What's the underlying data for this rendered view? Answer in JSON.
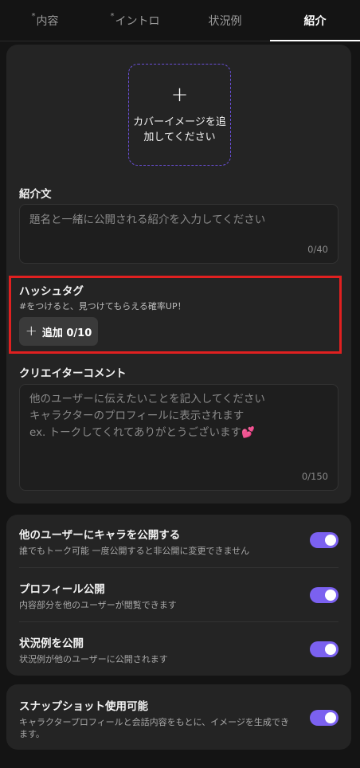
{
  "tabs": [
    {
      "label": "内容",
      "required_mark": "*"
    },
    {
      "label": "イントロ",
      "required_mark": "*"
    },
    {
      "label": "状況例",
      "required_mark": ""
    },
    {
      "label": "紹介",
      "required_mark": ""
    }
  ],
  "active_tab": "紹介",
  "cover": {
    "plus": "+",
    "label": "カバーイメージを追加してください"
  },
  "intro_text": {
    "label": "紹介文",
    "placeholder": "題名と一緒に公開される紹介を入力してください",
    "counter": "0/40"
  },
  "hashtag": {
    "label": "ハッシュタグ",
    "hint": "#をつけると、見つけてもらえる確率UP！",
    "add_plus": "+",
    "add_label": "追加 0/10"
  },
  "creator_comment": {
    "label": "クリエイターコメント",
    "placeholder_lines": [
      "他のユーザーに伝えたいことを記入してください",
      "キャラクターのプロフィールに表示されます",
      "ex. トークしてくれてありがとうございます"
    ],
    "heart": "💕",
    "counter": "0/150"
  },
  "toggles": [
    {
      "title": "他のユーザーにキャラを公開する",
      "desc": "誰でもトーク可能 一度公開すると非公開に変更できません",
      "on": true
    },
    {
      "title": "プロフィール公開",
      "desc": "内容部分を他のユーザーが閲覧できます",
      "on": true
    },
    {
      "title": "状況例を公開",
      "desc": "状況例が他のユーザーに公開されます",
      "on": true
    }
  ],
  "snapshot": {
    "title": "スナップショット使用可能",
    "desc": "キャラクタープロフィールと会話内容をもとに、イメージを生成できます。",
    "on": true
  },
  "colors": {
    "accent": "#7b61f0",
    "highlight": "#e02020",
    "background": "#141414",
    "card": "#242424"
  }
}
